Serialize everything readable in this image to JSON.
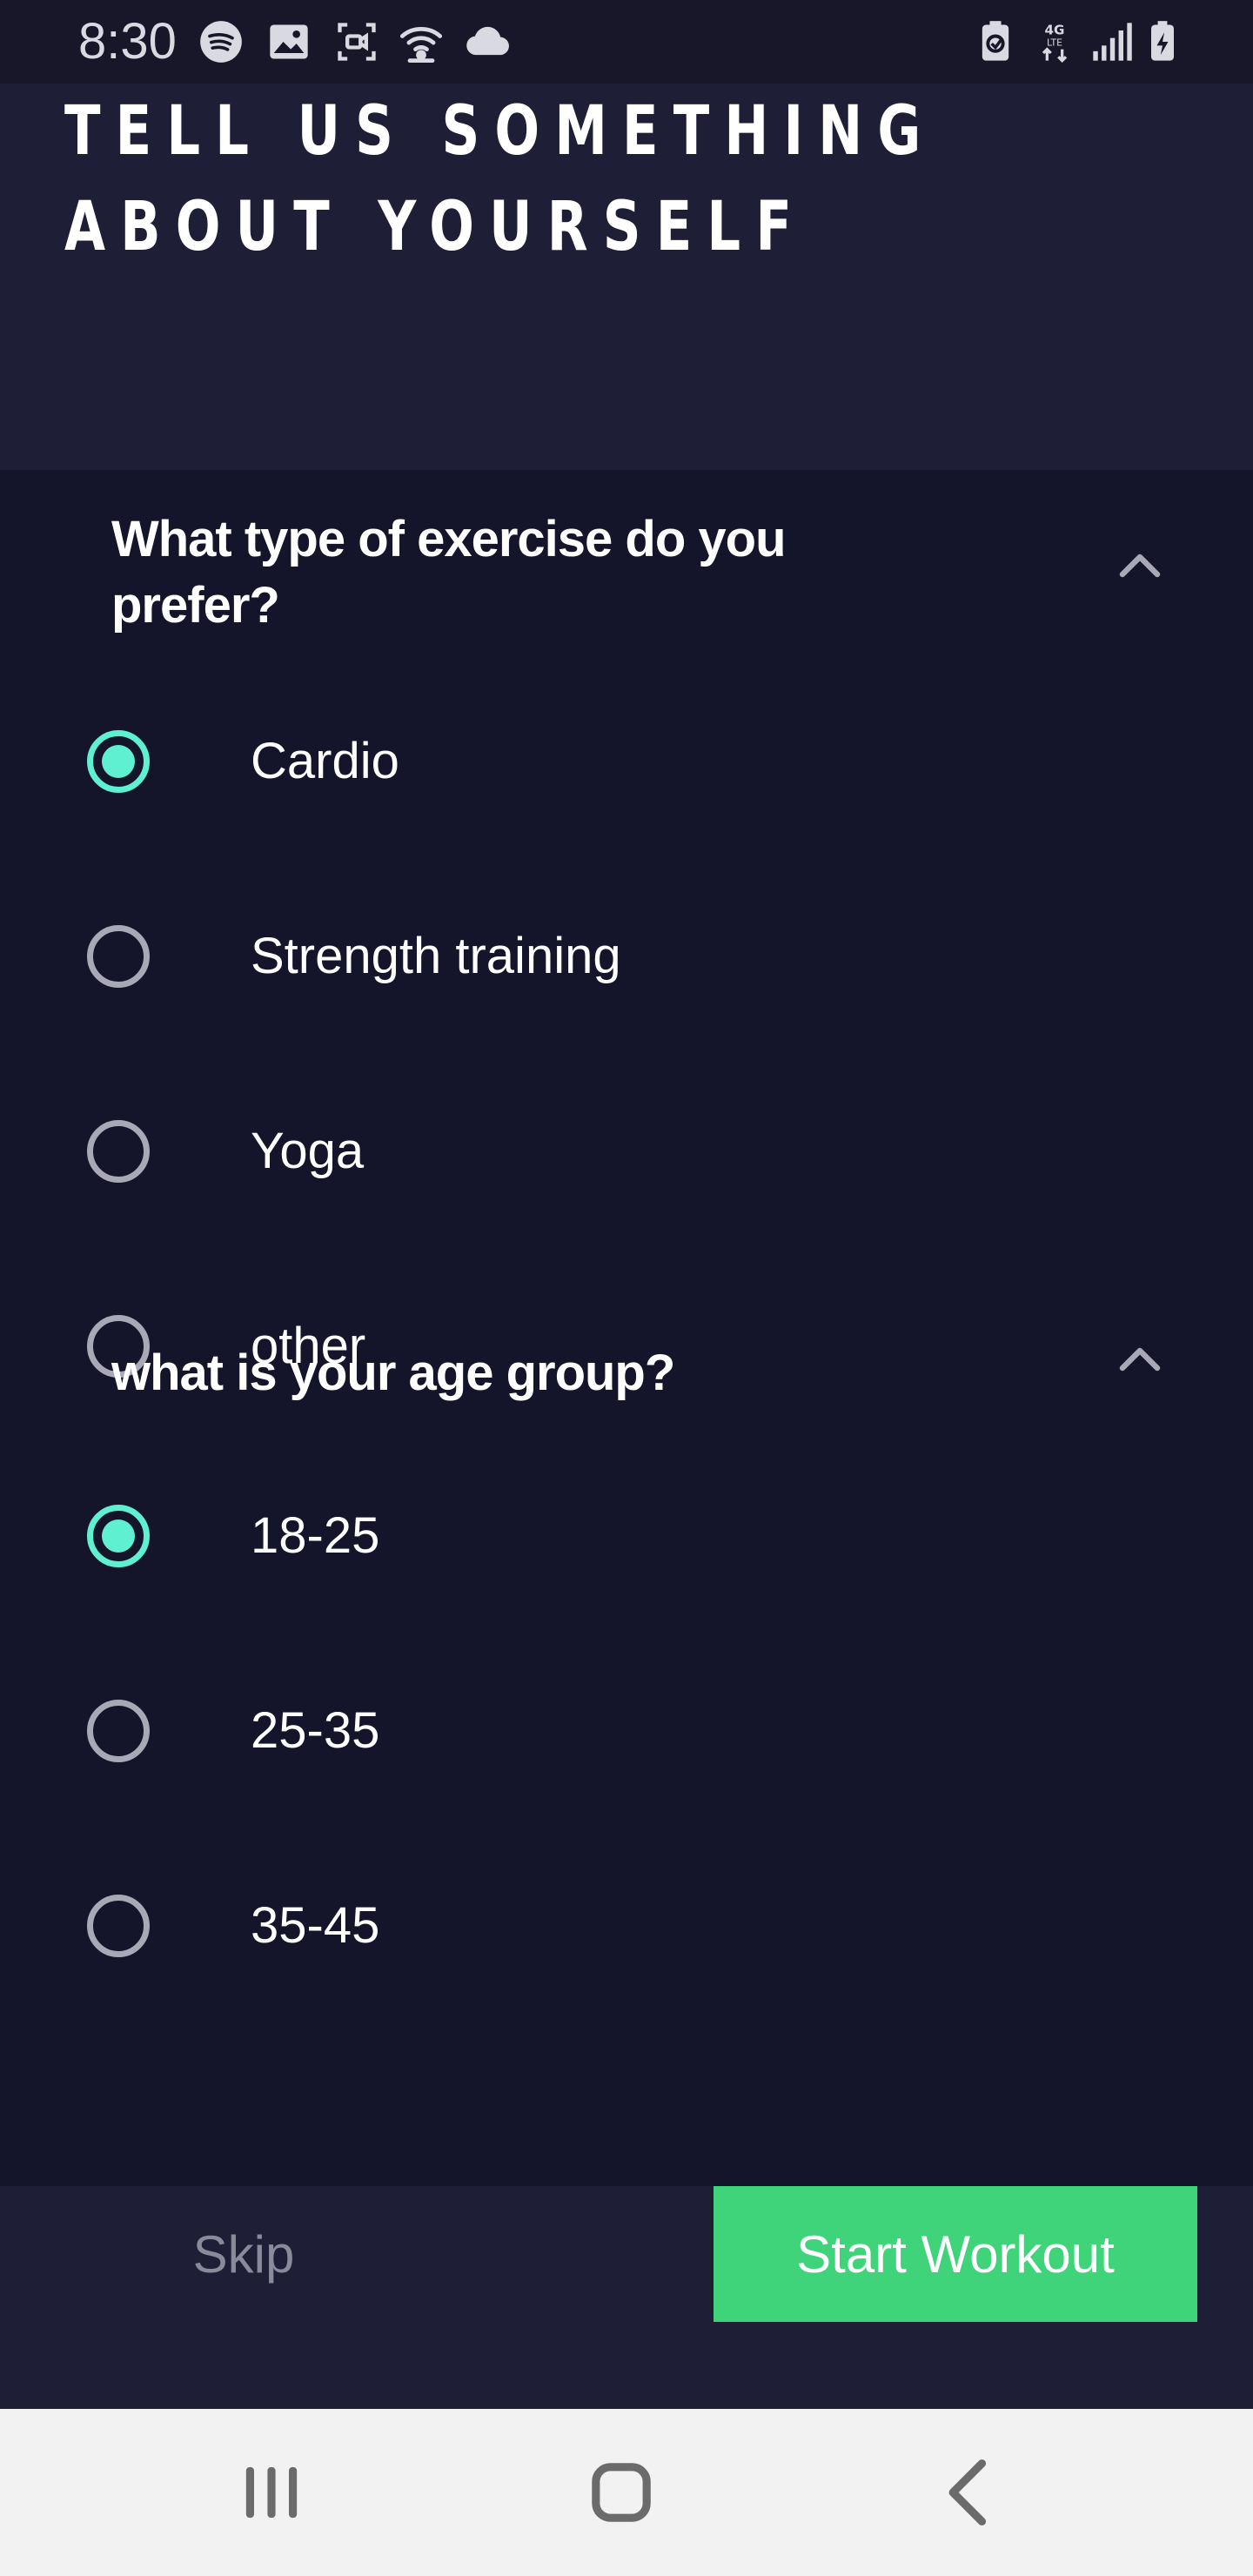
{
  "status_bar": {
    "time": "8:30",
    "left_icons": [
      "spotify-icon",
      "gallery-icon",
      "screen-record-icon",
      "wifi-hotspot-icon",
      "cloud-icon"
    ],
    "right_icons": [
      "battery-saver-icon",
      "4g-lte-icon",
      "signal-icon",
      "battery-charging-icon"
    ]
  },
  "header": {
    "title": "TELL US SOMETHING ABOUT YOURSELF"
  },
  "questions": [
    {
      "text": "What type of exercise do you prefer?",
      "expanded": true,
      "options": [
        {
          "label": "Cardio",
          "selected": true
        },
        {
          "label": "Strength training",
          "selected": false
        },
        {
          "label": "Yoga",
          "selected": false
        },
        {
          "label": "other",
          "selected": false
        }
      ]
    },
    {
      "text": "what is your age group?",
      "expanded": true,
      "options": [
        {
          "label": "18-25",
          "selected": true
        },
        {
          "label": "25-35",
          "selected": false
        },
        {
          "label": "35-45",
          "selected": false
        }
      ]
    }
  ],
  "footer": {
    "skip_label": "Skip",
    "start_label": "Start Workout"
  },
  "nav_bar": {
    "icons": [
      "recent-apps-icon",
      "home-icon",
      "back-icon"
    ]
  },
  "colors": {
    "accent": "#5ff0d2",
    "primary_button": "#3fd37a",
    "background": "#1e1e36",
    "panel": "#14142a"
  }
}
